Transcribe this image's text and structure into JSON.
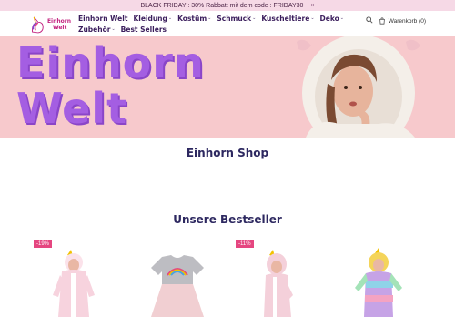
{
  "announcement": {
    "text": "BLACK FRIDAY : 30% Rabbatt mit dem code : FRIDAY30",
    "close": "×"
  },
  "logo": {
    "line1": "Einhorn",
    "line2": "Welt"
  },
  "nav": {
    "row1": [
      {
        "label": "Einhorn Welt",
        "dropdown": false
      },
      {
        "label": "Kleidung",
        "dropdown": true
      },
      {
        "label": "Kostüm",
        "dropdown": true
      },
      {
        "label": "Schmuck",
        "dropdown": true
      },
      {
        "label": "Kuscheltiere",
        "dropdown": true
      },
      {
        "label": "Deko",
        "dropdown": true
      }
    ],
    "row2": [
      {
        "label": "Zubehör",
        "dropdown": true
      },
      {
        "label": "Best Sellers",
        "dropdown": false
      }
    ]
  },
  "cart": {
    "label": "Warenkorb (0)"
  },
  "hero": {
    "line1": "Einhorn",
    "line2": "Welt"
  },
  "sections": {
    "shop_title": "Einhorn Shop",
    "bestseller_title": "Unsere Bestseller"
  },
  "products": [
    {
      "badge": "-19%"
    },
    {
      "badge": ""
    },
    {
      "badge": "-11%"
    },
    {
      "badge": ""
    }
  ],
  "colors": {
    "announcement_bg": "#f6d9e6",
    "hero_bg": "#f7c9cc",
    "hero_text": "#a45ee2",
    "heading": "#2d2860",
    "badge": "#e54680"
  }
}
